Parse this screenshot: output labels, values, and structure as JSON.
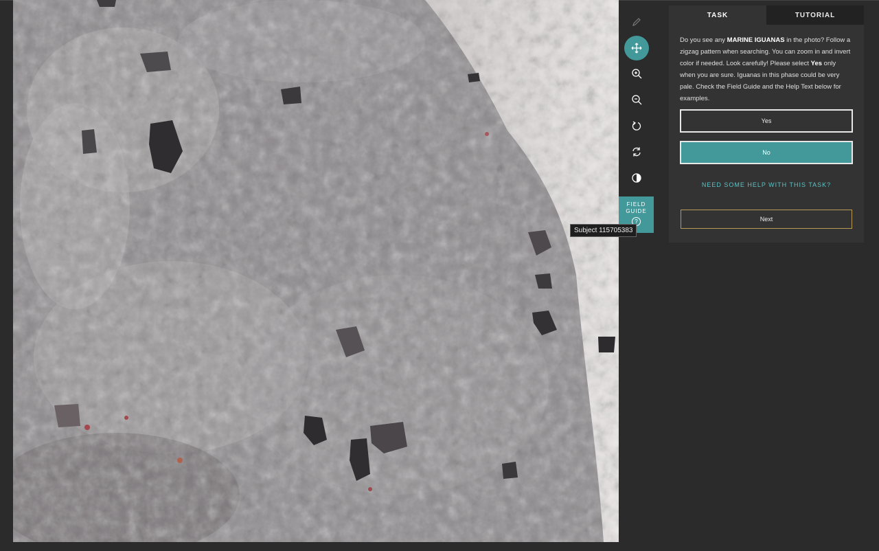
{
  "subject": {
    "tooltip": "Subject 115705383"
  },
  "toolbar": {
    "tools": [
      {
        "name": "annotate",
        "icon": "pencil-icon",
        "active": false
      },
      {
        "name": "pan",
        "icon": "move-icon",
        "active": true
      },
      {
        "name": "zoom-in",
        "icon": "zoom-in-icon",
        "active": false
      },
      {
        "name": "zoom-out",
        "icon": "zoom-out-icon",
        "active": false
      },
      {
        "name": "rotate",
        "icon": "rotate-icon",
        "active": false
      },
      {
        "name": "reset",
        "icon": "reset-icon",
        "active": false
      },
      {
        "name": "invert",
        "icon": "contrast-icon",
        "active": false
      }
    ],
    "field_guide": {
      "line1": "FIELD",
      "line2": "GUIDE",
      "icon": "?"
    }
  },
  "panel": {
    "tabs": [
      {
        "label": "TASK"
      },
      {
        "label": "TUTORIAL"
      }
    ],
    "question": {
      "part1": "Do you see any ",
      "bold1": "MARINE IGUANAS",
      "part2": " in the photo? Follow a zigzag pattern when searching. You can zoom in and invert color if needed. Look carefully! Please select ",
      "bold2": "Yes",
      "part3": " only when you are sure. Iguanas in this phase could be very pale. Check the Field Guide and the Help Text below for examples."
    },
    "answers": [
      {
        "label": "Yes"
      },
      {
        "label": "No"
      }
    ],
    "help_label": "NEED SOME HELP WITH THIS TASK?",
    "next_label": "Next"
  },
  "colors": {
    "accent": "#43999a",
    "background": "#2b2b2b",
    "panel": "#333333",
    "next_border": "#b89a55"
  }
}
